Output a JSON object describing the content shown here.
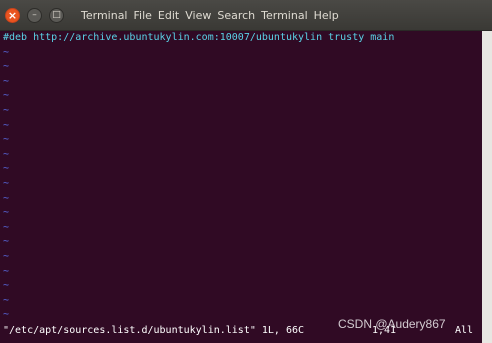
{
  "titlebar": {
    "close_label": "×",
    "minimize_label": "–",
    "maximize_label": "□",
    "menu": [
      "Terminal",
      "File",
      "Edit",
      "View",
      "Search",
      "Terminal",
      "Help"
    ]
  },
  "editor": {
    "first_line": "#deb http://archive.ubuntukylin.com:10007/ubuntukylin trusty main",
    "tilde_char": "~",
    "status_file": "\"/etc/apt/sources.list.d/ubuntukylin.list\" 1L, 66C",
    "status_pos": "1,41",
    "status_view": "All"
  },
  "watermark": "CSDN @Audery867",
  "colors": {
    "background": "#300a24",
    "text": "#ffffff",
    "comment": "#5ad2e6",
    "tilde": "#5a6ee8",
    "accent": "#e95420"
  }
}
